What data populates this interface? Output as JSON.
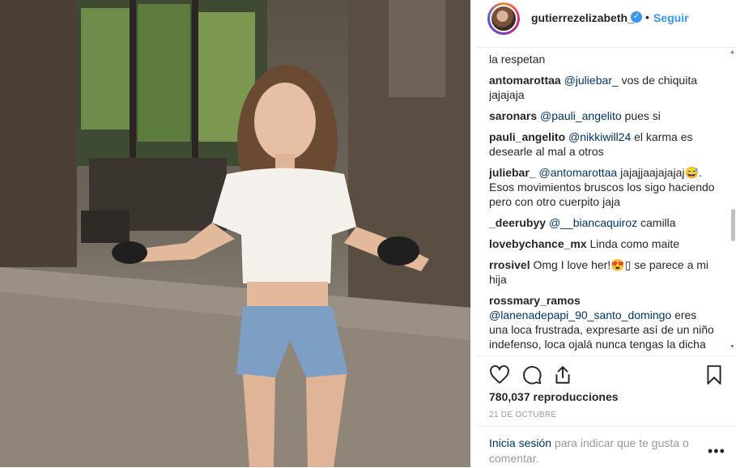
{
  "post": {
    "username": "gutierrezelizabeth_",
    "separator": "•",
    "follow_label": "Seguir",
    "verified_icon": "verified-badge-icon"
  },
  "comments": [
    {
      "username": "",
      "mention": "",
      "text": "la respetan"
    },
    {
      "username": "antomarottaa",
      "mention": "@juliebar_",
      "text": " vos de chiquita jajajaja"
    },
    {
      "username": "saronars",
      "mention": "@pauli_angelito",
      "text": " pues si"
    },
    {
      "username": "pauli_angelito",
      "mention": "@nikkiwill24",
      "text": " el karma es desearle al mal a otros"
    },
    {
      "username": "juliebar_",
      "mention": "@antomarottaa",
      "text": " jajajjaajajajaj😅. Esos movimientos bruscos los sigo haciendo pero con otro cuerpito jaja"
    },
    {
      "username": "_deerubyy",
      "mention": "@__biancaquiroz",
      "text": " camilla"
    },
    {
      "username": "lovebychance_mx",
      "mention": "",
      "text": "Linda como maite"
    },
    {
      "username": "rrosivel",
      "mention": "",
      "text": "Omg I love her!😍▯ se parece a mi hija"
    },
    {
      "username": "rossmary_ramos",
      "mention": "@lanenadepapi_90_santo_domingo",
      "text": " eres una loca frustrada, expresarte así de un niño indefenso, loca ojalá nunca tengas la dicha de ser madre y si es así, pobre bebe!!! Loca frustrada."
    }
  ],
  "stats": {
    "views": "780,037 reproducciones",
    "date": "21 DE OCTUBRE"
  },
  "footer": {
    "login_link": "Inicia sesión",
    "login_rest": " para indicar que te gusta o comentar.",
    "more": "•••"
  },
  "colors": {
    "accent": "#3897f0",
    "link": "#003569",
    "text": "#262626",
    "muted": "#999999"
  }
}
